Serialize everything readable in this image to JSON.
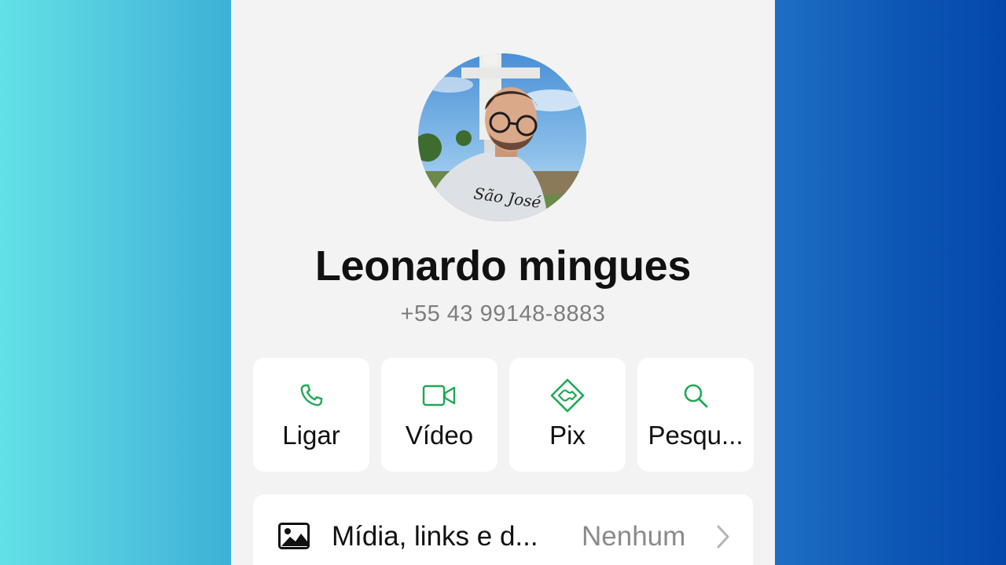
{
  "colors": {
    "accent_green": "#1fa855",
    "background_left": "#62e1e6",
    "background_right": "#0447ab",
    "panel_background": "#f3f3f3"
  },
  "contact": {
    "avatar_icon": "profile-photo",
    "avatar_shirt_text": "São José",
    "name": "Leonardo mingues",
    "phone": "+55 43 99148-8883"
  },
  "actions": [
    {
      "label": "Ligar",
      "icon": "phone-icon"
    },
    {
      "label": "Vídeo",
      "icon": "video-icon"
    },
    {
      "label": "Pix",
      "icon": "pix-icon"
    },
    {
      "label": "Pesqu...",
      "icon": "search-icon"
    }
  ],
  "media": {
    "icon": "image-icon",
    "label": "Mídia, links e d...",
    "value": "Nenhum"
  }
}
